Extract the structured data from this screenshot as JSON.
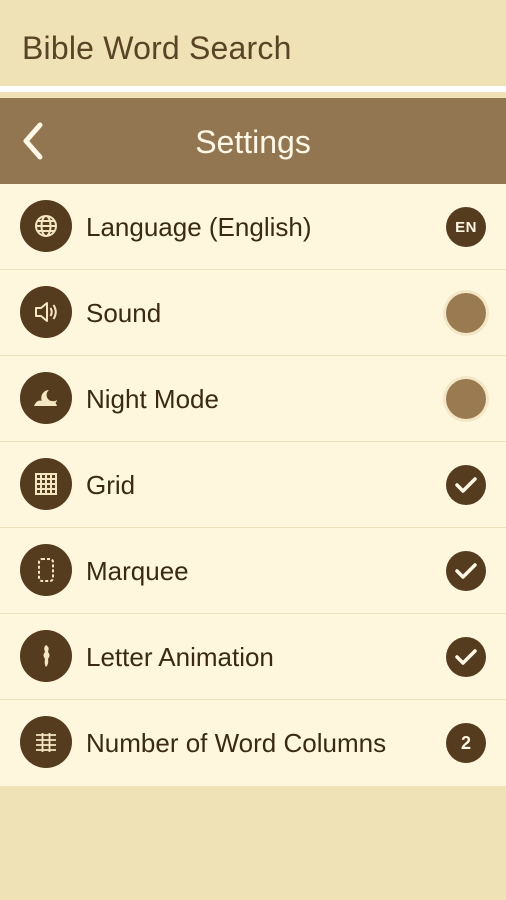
{
  "app": {
    "title": "Bible Word Search"
  },
  "header": {
    "title": "Settings",
    "back_icon": "chevron-left-icon"
  },
  "colors": {
    "background": "#efe2b6",
    "header": "#917651",
    "list_bg": "#fff6de",
    "icon_circle": "#553c1e",
    "toggle_off": "#9a7b51"
  },
  "settings": [
    {
      "label": "Language (English)",
      "icon": "globe-icon",
      "control": "badge",
      "value": "EN"
    },
    {
      "label": "Sound",
      "icon": "speaker-icon",
      "control": "toggle",
      "checked": false
    },
    {
      "label": "Night Mode",
      "icon": "moon-icon",
      "control": "toggle",
      "checked": false
    },
    {
      "label": "Grid",
      "icon": "grid-icon",
      "control": "toggle",
      "checked": true
    },
    {
      "label": "Marquee",
      "icon": "marquee-icon",
      "control": "toggle",
      "checked": true
    },
    {
      "label": "Letter Animation",
      "icon": "letter-animation-icon",
      "control": "toggle",
      "checked": true
    },
    {
      "label": "Number of Word Columns",
      "icon": "columns-icon",
      "control": "badge",
      "value": "2"
    }
  ]
}
